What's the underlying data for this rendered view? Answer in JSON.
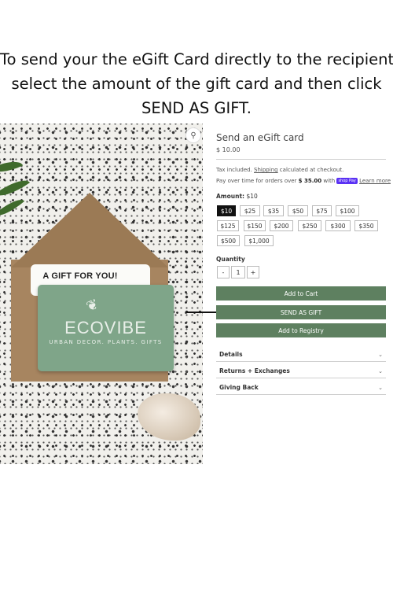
{
  "headline": {
    "line1": "To send your the eGift Card directly to the recipient,",
    "line2": "select the amount of the gift card and then click",
    "line3": "SEND AS GIFT."
  },
  "image": {
    "insert_text": "A GIFT FOR YOU!",
    "brand": "ECOVIBE",
    "tagline": "URBAN DECOR. PLANTS. GIFTS",
    "zoom_icon": "search-icon"
  },
  "product": {
    "title": "Send an eGift card",
    "price": "$ 10.00",
    "tax_prefix": "Tax included. ",
    "shipping_link": "Shipping",
    "tax_suffix": " calculated at checkout.",
    "pay_prefix": "Pay over time for orders over ",
    "pay_amount": "$ 35.00",
    "pay_with": " with ",
    "shoppay": "shop Pay",
    "learn_more": "Learn more",
    "amount_label": "Amount:",
    "amount_value": "$10",
    "amounts": [
      "$10",
      "$25",
      "$35",
      "$50",
      "$75",
      "$100",
      "$125",
      "$150",
      "$200",
      "$250",
      "$300",
      "$350",
      "$500",
      "$1,000"
    ],
    "selected_amount": "$10",
    "quantity_label": "Quantity",
    "quantity": "1",
    "minus": "-",
    "plus": "+",
    "add_to_cart": "Add to Cart",
    "send_as_gift": "SEND AS GIFT",
    "add_to_registry": "Add to Registry",
    "accordions": [
      "Details",
      "Returns + Exchanges",
      "Giving Back"
    ]
  },
  "colors": {
    "button_green": "#5e8060",
    "card_green": "#7fa589",
    "selected_amount_bg": "#111111"
  }
}
